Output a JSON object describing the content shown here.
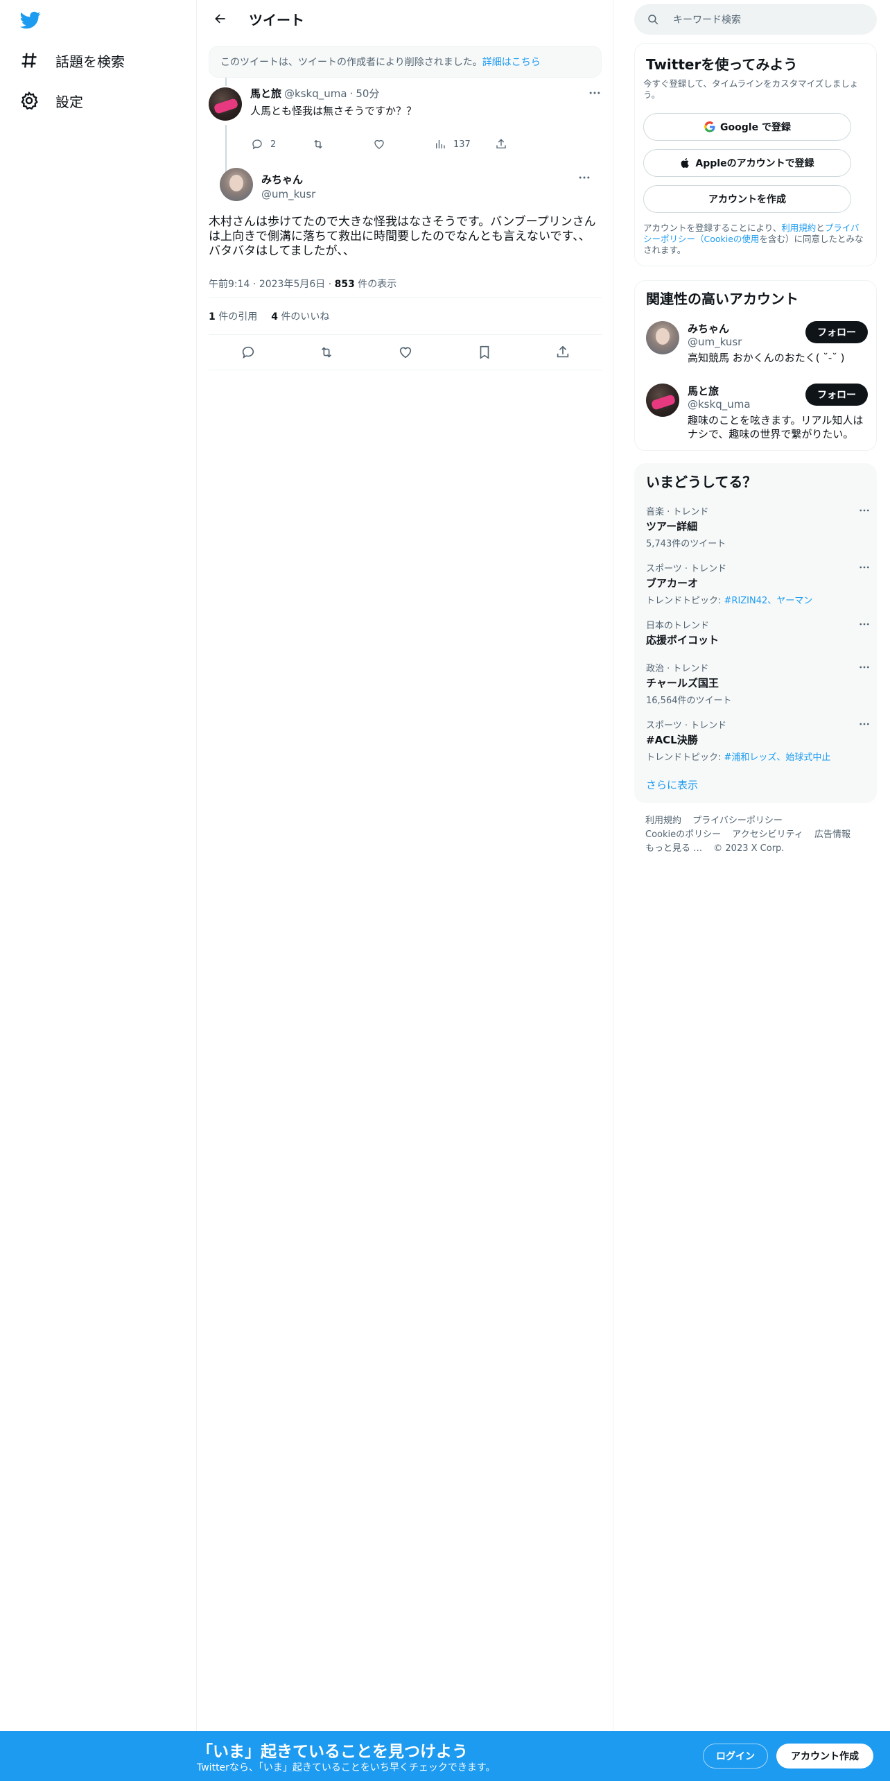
{
  "nav": {
    "items": [
      {
        "label": "話題を検索",
        "icon": "hashtag-icon"
      },
      {
        "label": "設定",
        "icon": "gear-icon"
      }
    ]
  },
  "header": {
    "title": "ツイート"
  },
  "deleted_notice": {
    "text": "このツイートは、ツイートの作成者により削除されました。",
    "link": "詳細はこちら"
  },
  "parent_tweet": {
    "name": "馬と旅",
    "handle": "@kskq_uma",
    "sep": "·",
    "time": "50分",
    "text": "人馬とも怪我は無さそうですか？？",
    "replies": "2",
    "views": "137"
  },
  "main_tweet": {
    "name": "みちゃん",
    "handle": "@um_kusr",
    "text": "木村さんは歩けてたので大きな怪我はなさそうです。バンブープリンさんは上向きで側溝に落ちて救出に時間要したのでなんとも言えないです、、バタバタはしてましたが、、",
    "time": "午前9:14",
    "sep": "·",
    "date": "2023年5月6日",
    "views_count": "853",
    "views_label": " 件の表示",
    "quotes_count": "1",
    "quotes_label": " 件の引用",
    "likes_count": "4",
    "likes_label": " 件のいいね"
  },
  "search": {
    "placeholder": "キーワード検索"
  },
  "signup_card": {
    "title": "Twitterを使ってみよう",
    "subtitle": "今すぐ登録して、タイムラインをカスタマイズしましょう。",
    "google_btn": "Google で登録",
    "apple_btn": "Appleのアカウントで登録",
    "create_btn": "アカウントを作成",
    "legal_1": "アカウントを登録することにより、",
    "legal_terms": "利用規約",
    "legal_2": "と",
    "legal_privacy": "プライバシーポリシー（Cookieの使用",
    "legal_3": "を含む）に同意したとみなされます。"
  },
  "related": {
    "title": "関連性の高いアカウント",
    "accounts": [
      {
        "name": "みちゃん",
        "handle": "@um_kusr",
        "bio": "高知競馬 おかくんのおたく( ˘-˘ )",
        "follow": "フォロー"
      },
      {
        "name": "馬と旅",
        "handle": "@kskq_uma",
        "bio": "趣味のことを呟きます。リアル知人はナシで、趣味の世界で繋がりたい。",
        "follow": "フォロー"
      }
    ]
  },
  "trends": {
    "title": "いまどうしてる？",
    "items": [
      {
        "context": "音楽 · トレンド",
        "title": "ツアー詳細",
        "count": "5,743件のツイート",
        "topic_label": "",
        "topics": ""
      },
      {
        "context": "スポーツ · トレンド",
        "title": "ブアカーオ",
        "count": "",
        "topic_label": "トレンドトピック: ",
        "topics": "#RIZIN42、ヤーマン"
      },
      {
        "context": "日本のトレンド",
        "title": "応援ボイコット",
        "count": "",
        "topic_label": "",
        "topics": ""
      },
      {
        "context": "政治 · トレンド",
        "title": "チャールズ国王",
        "count": "16,564件のツイート",
        "topic_label": "",
        "topics": ""
      },
      {
        "context": "スポーツ · トレンド",
        "title": "#ACL決勝",
        "count": "",
        "topic_label": "トレンドトピック: ",
        "topics": "#浦和レッズ、始球式中止"
      }
    ],
    "show_more": "さらに表示"
  },
  "footer": {
    "line1": [
      "利用規約",
      "プライバシーポリシー"
    ],
    "line2": [
      "Cookieのポリシー",
      "アクセシビリティ",
      "広告情報"
    ],
    "more": "もっと見る …",
    "copyright": "© 2023 X Corp."
  },
  "banner": {
    "title": "「いま」起きていることを見つけよう",
    "desc": "Twitterなら、「いま」起きていることをいち早くチェックできます。",
    "login": "ログイン",
    "signup": "アカウント作成"
  },
  "colors": {
    "accent": "#1d9bf0",
    "text": "#0f1419",
    "muted": "#536471"
  }
}
